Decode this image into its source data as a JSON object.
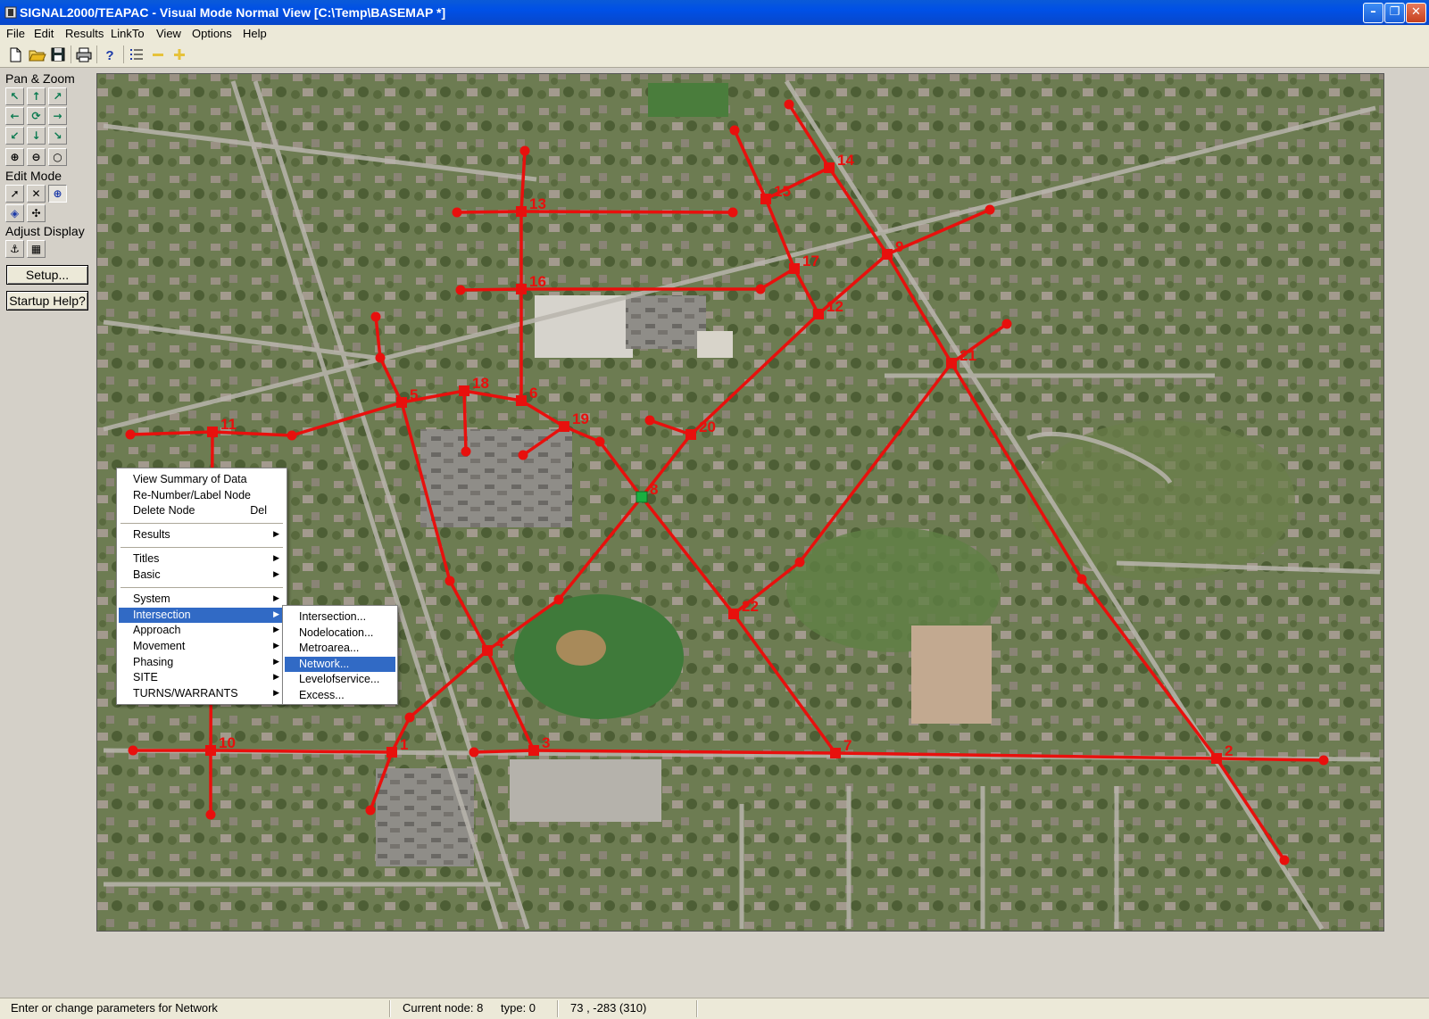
{
  "window": {
    "title": "SIGNAL2000/TEAPAC - Visual Mode Normal View [C:\\Temp\\BASEMAP *]",
    "minimize_glyph": "–",
    "restore_glyph": "❐",
    "close_glyph": "✕"
  },
  "menubar": [
    "File",
    "Edit",
    "Results",
    "LinkTo",
    "View",
    "Options",
    "Help"
  ],
  "toolbar_icons": [
    "new-file-icon",
    "open-folder-icon",
    "save-icon",
    "print-icon",
    "help-icon",
    "list-icon",
    "minus-icon",
    "plus-icon"
  ],
  "left_panel": {
    "pan_zoom_label": "Pan & Zoom",
    "edit_mode_label": "Edit Mode",
    "adjust_display_label": "Adjust Display",
    "setup_label": "Setup...",
    "startup_help_label": "Startup Help?"
  },
  "map": {
    "link_color": "#e8100d",
    "selected_node_color": "#18b040",
    "label_color": "#e8100d",
    "nodes": [
      {
        "id": "1",
        "label": "1"
      },
      {
        "id": "2",
        "label": "2"
      },
      {
        "id": "3",
        "label": "3"
      },
      {
        "id": "4",
        "label": "4"
      },
      {
        "id": "5",
        "label": "5"
      },
      {
        "id": "6",
        "label": "6"
      },
      {
        "id": "7",
        "label": "7"
      },
      {
        "id": "8",
        "label": "8",
        "selected": true
      },
      {
        "id": "9",
        "label": "9"
      },
      {
        "id": "10",
        "label": "10"
      },
      {
        "id": "11",
        "label": "11"
      },
      {
        "id": "12",
        "label": "12"
      },
      {
        "id": "13",
        "label": "13"
      },
      {
        "id": "14",
        "label": "14"
      },
      {
        "id": "15",
        "label": "15"
      },
      {
        "id": "16",
        "label": "16"
      },
      {
        "id": "17",
        "label": "17"
      },
      {
        "id": "18",
        "label": "18"
      },
      {
        "id": "19",
        "label": "19"
      },
      {
        "id": "20",
        "label": "20"
      },
      {
        "id": "21",
        "label": "21"
      },
      {
        "id": "22",
        "label": "22"
      }
    ]
  },
  "context_menu": {
    "items": [
      {
        "label": "View Summary of Data"
      },
      {
        "label": "Re-Number/Label Node"
      },
      {
        "label": "Delete Node",
        "shortcut": "Del"
      },
      {
        "separator": true
      },
      {
        "label": "Results",
        "submenu": true
      },
      {
        "separator": true
      },
      {
        "label": "Titles",
        "submenu": true
      },
      {
        "label": "Basic",
        "submenu": true
      },
      {
        "separator": true
      },
      {
        "label": "System",
        "submenu": true
      },
      {
        "label": "Intersection",
        "submenu": true,
        "selected": true
      },
      {
        "label": "Approach",
        "submenu": true
      },
      {
        "label": "Movement",
        "submenu": true
      },
      {
        "label": "Phasing",
        "submenu": true
      },
      {
        "label": "SITE",
        "submenu": true
      },
      {
        "label": "TURNS/WARRANTS",
        "submenu": true
      }
    ],
    "submenu_arrow": "▶"
  },
  "submenu": {
    "items": [
      {
        "label": "Intersection..."
      },
      {
        "label": "Nodelocation..."
      },
      {
        "label": "Metroarea..."
      },
      {
        "label": "Network...",
        "selected": true
      },
      {
        "label": "Levelofservice..."
      },
      {
        "label": "Excess..."
      }
    ]
  },
  "statusbar": {
    "message": "Enter or change parameters for Network",
    "current_node": "Current node: 8",
    "type": "type: 0",
    "coords": "73 , -283 (310)"
  }
}
